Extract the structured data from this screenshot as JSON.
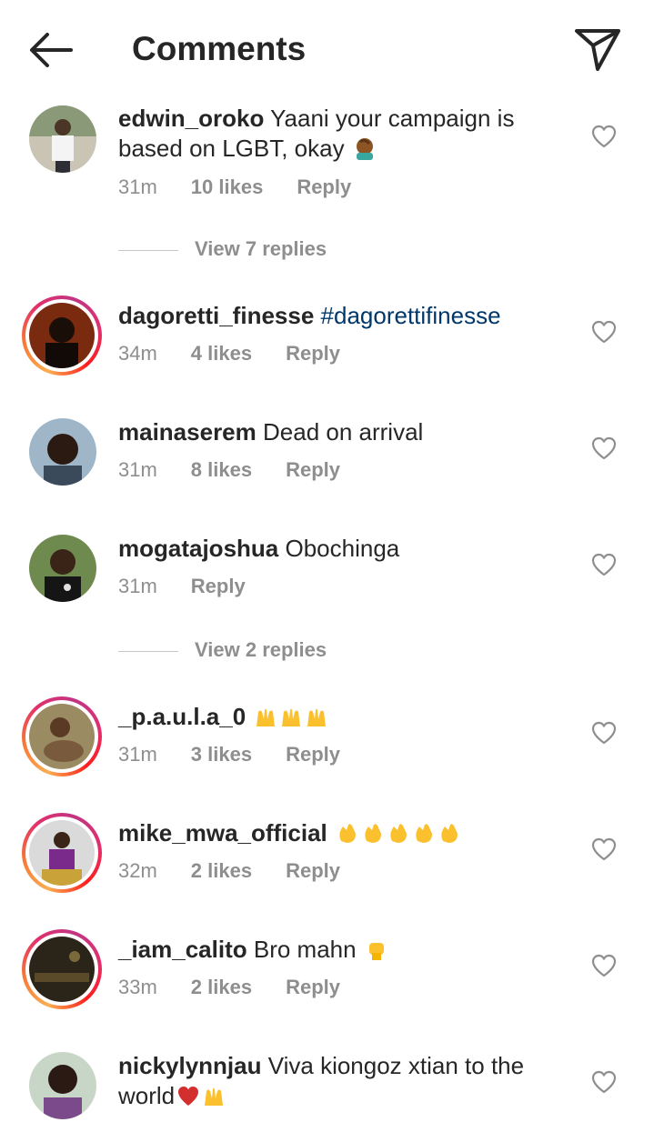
{
  "header": {
    "title": "Comments"
  },
  "comments": [
    {
      "username": "edwin_oroko",
      "text": "Yaani your campaign is based on LGBT, okay",
      "time": "31m",
      "likes": "10 likes",
      "reply": "Reply"
    },
    {
      "username": "dagoretti_finesse",
      "text": "#dagorettifinesse",
      "time": "34m",
      "likes": "4 likes",
      "reply": "Reply"
    },
    {
      "username": "mainaserem",
      "text": "Dead on arrival",
      "time": "31m",
      "likes": "8 likes",
      "reply": "Reply"
    },
    {
      "username": "mogatajoshua",
      "text": "Obochinga",
      "time": "31m",
      "likes": "",
      "reply": "Reply"
    },
    {
      "username": "_p.a.u.l.a_0",
      "text": "",
      "time": "31m",
      "likes": "3 likes",
      "reply": "Reply"
    },
    {
      "username": "mike_mwa_official",
      "text": "",
      "time": "32m",
      "likes": "2 likes",
      "reply": "Reply"
    },
    {
      "username": "_iam_calito",
      "text": "Bro mahn",
      "time": "33m",
      "likes": "2 likes",
      "reply": "Reply"
    },
    {
      "username": "nickylynnjau",
      "text": "Viva kiongoz xtian to the world",
      "time": "",
      "likes": "",
      "reply": ""
    }
  ],
  "view_replies": [
    "View 7 replies",
    "View 2 replies"
  ],
  "icons": {
    "back": "arrow-left-icon",
    "send": "paper-plane-icon",
    "heart": "heart-outline-icon",
    "emoji_facepalm": "facepalm-emoji",
    "emoji_raised_hands": "raised-hands-emoji",
    "emoji_clap": "clapping-hands-emoji",
    "emoji_fist": "raised-fist-emoji",
    "emoji_heart": "red-heart-emoji"
  },
  "colors": {
    "hashtag": "#00376b",
    "meta": "#8e8e8e",
    "text": "#262626"
  }
}
